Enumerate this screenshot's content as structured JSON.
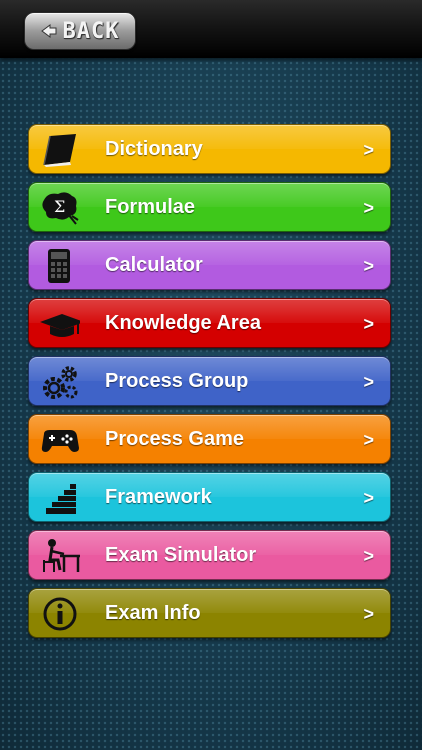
{
  "header": {
    "back_label": "BACK",
    "back_icon": "back-arrow-icon"
  },
  "menu": {
    "chevron": ">",
    "items": [
      {
        "label": "Dictionary",
        "icon": "book-icon",
        "color": "#f5b800"
      },
      {
        "label": "Formulae",
        "icon": "sigma-icon",
        "color": "#3ec81a"
      },
      {
        "label": "Calculator",
        "icon": "calculator-icon",
        "color": "#b25be0"
      },
      {
        "label": "Knowledge Area",
        "icon": "graduation-cap-icon",
        "color": "#d40000"
      },
      {
        "label": "Process Group",
        "icon": "gears-icon",
        "color": "#3f63c8"
      },
      {
        "label": "Process Game",
        "icon": "gamepad-icon",
        "color": "#f58100"
      },
      {
        "label": "Framework",
        "icon": "stairs-icon",
        "color": "#1cc4dc"
      },
      {
        "label": "Exam Simulator",
        "icon": "student-desk-icon",
        "color": "#ea5aa0"
      },
      {
        "label": "Exam Info",
        "icon": "info-icon",
        "color": "#8c8400"
      }
    ]
  }
}
